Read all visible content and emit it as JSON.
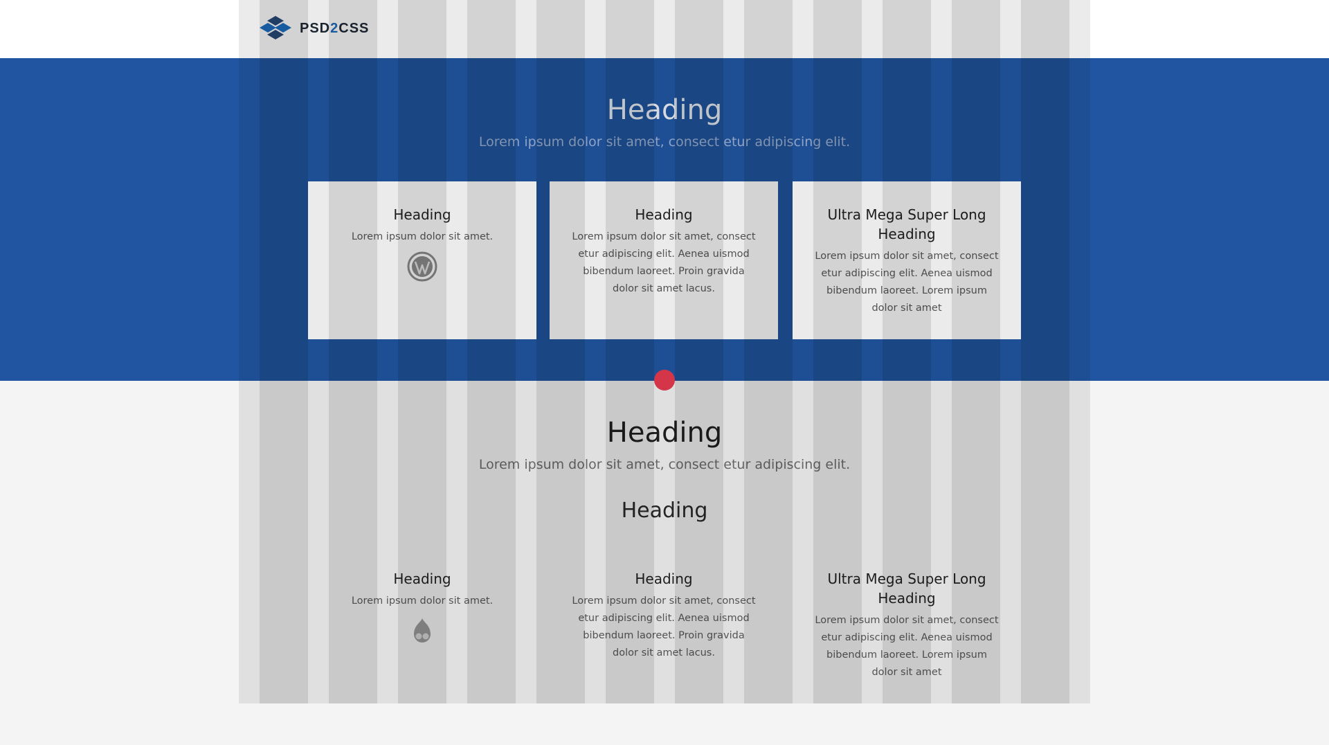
{
  "brand": {
    "logo_text_prefix": "PSD",
    "logo_text_accent": "2",
    "logo_text_suffix": "CSS",
    "accent_color": "#1e6fc0",
    "hero_color": "#2155a1",
    "dot_color": "#e63a4f"
  },
  "hero": {
    "title": "Heading",
    "subtitle": "Lorem ipsum dolor sit amet, consect etur adipiscing elit.",
    "cards": [
      {
        "title": "Heading",
        "text": "Lorem ipsum dolor sit amet.",
        "icon": "wordpress-icon"
      },
      {
        "title": "Heading",
        "text": "Lorem ipsum dolor sit amet, consect etur adipiscing elit. Aenea uismod bibendum laoreet. Proin gravida dolor sit amet lacus."
      },
      {
        "title": "Ultra Mega Super Long Heading",
        "text": "Lorem ipsum dolor sit amet, consect etur adipiscing elit. Aenea uismod bibendum laoreet. Lorem ipsum dolor sit amet"
      }
    ]
  },
  "section2": {
    "title": "Heading",
    "subtitle": "Lorem ipsum dolor sit amet, consect etur adipiscing elit.",
    "subheading": "Heading",
    "cards": [
      {
        "title": "Heading",
        "text": "Lorem ipsum dolor sit amet.",
        "icon": "drupal-icon"
      },
      {
        "title": "Heading",
        "text": "Lorem ipsum dolor sit amet, consect etur adipiscing elit. Aenea uismod bibendum laoreet. Proin gravida dolor sit amet lacus."
      },
      {
        "title": "Ultra Mega Super Long Heading",
        "text": "Lorem ipsum dolor sit amet, consect etur adipiscing elit. Aenea uismod bibendum laoreet. Lorem ipsum dolor sit amet"
      }
    ]
  }
}
